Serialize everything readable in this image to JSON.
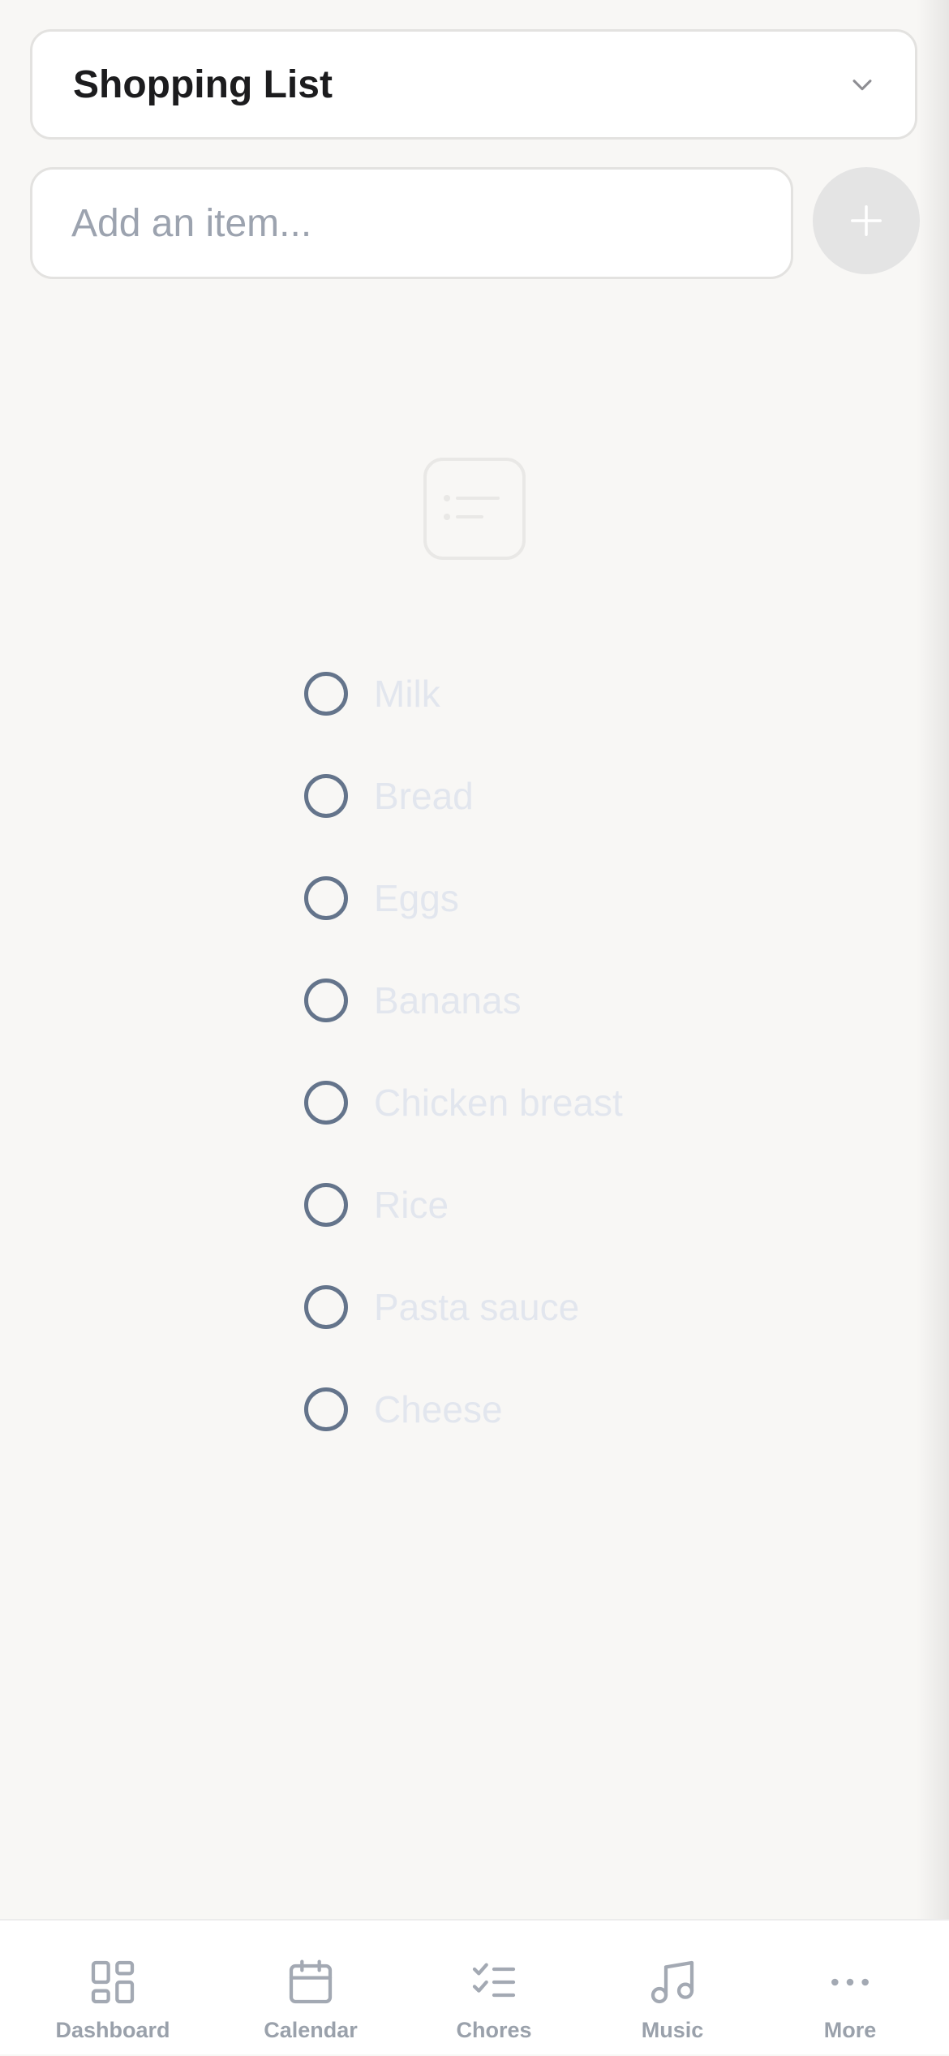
{
  "list_selector": {
    "title": "Shopping List",
    "icon": "chevron-down-icon"
  },
  "add_item": {
    "placeholder": "Add an item...",
    "button_icon": "plus-icon"
  },
  "empty_state": {
    "icon": "list-icon"
  },
  "items": [
    {
      "label": "Milk",
      "checked": false
    },
    {
      "label": "Bread",
      "checked": false
    },
    {
      "label": "Eggs",
      "checked": false
    },
    {
      "label": "Bananas",
      "checked": false
    },
    {
      "label": "Chicken breast",
      "checked": false
    },
    {
      "label": "Rice",
      "checked": false
    },
    {
      "label": "Pasta sauce",
      "checked": false
    },
    {
      "label": "Cheese",
      "checked": false
    }
  ],
  "nav": [
    {
      "label": "Dashboard",
      "icon": "dashboard-icon"
    },
    {
      "label": "Calendar",
      "icon": "calendar-icon"
    },
    {
      "label": "Chores",
      "icon": "checklist-icon"
    },
    {
      "label": "Music",
      "icon": "music-note-icon"
    },
    {
      "label": "More",
      "icon": "more-dots-icon"
    }
  ],
  "colors": {
    "background": "#f8f7f5",
    "checkbox_border": "#64748b",
    "item_text": "#e2e6ee",
    "nav_text": "#9aa1ab"
  }
}
